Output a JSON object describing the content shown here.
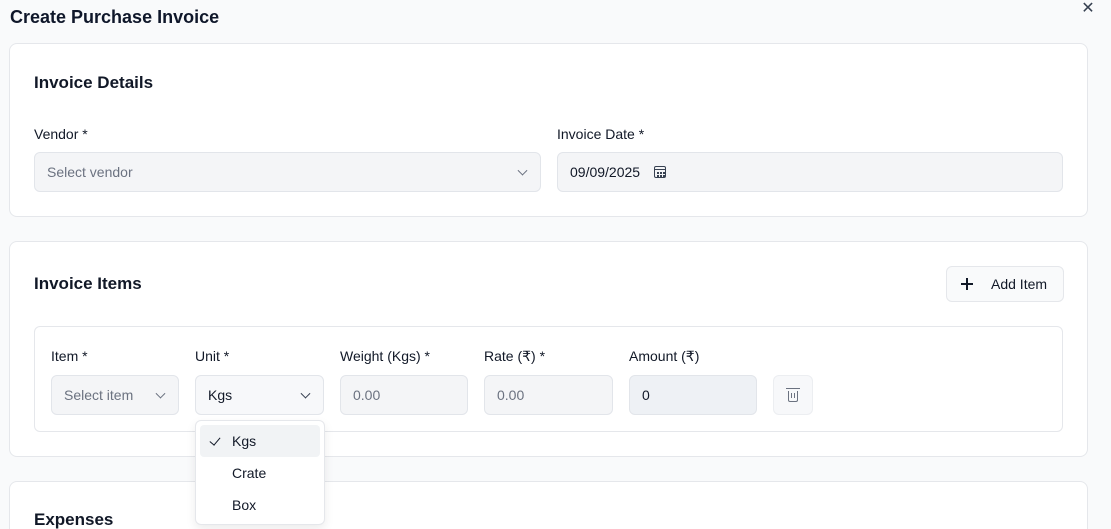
{
  "dialog": {
    "title": "Create Purchase Invoice",
    "close_icon": "close-icon"
  },
  "invoice_details": {
    "title": "Invoice Details",
    "vendor": {
      "label": "Vendor *",
      "placeholder": "Select vendor"
    },
    "invoice_date": {
      "label": "Invoice Date *",
      "value": "09/09/2025"
    }
  },
  "invoice_items": {
    "title": "Invoice Items",
    "add_item_label": "Add Item",
    "columns": {
      "item": "Item *",
      "unit": "Unit *",
      "weight": "Weight (Kgs) *",
      "rate": "Rate (₹) *",
      "amount": "Amount (₹)"
    },
    "row": {
      "item_placeholder": "Select item",
      "unit_value": "Kgs",
      "weight_placeholder": "0.00",
      "rate_placeholder": "0.00",
      "amount_value": "0"
    },
    "unit_options": [
      {
        "label": "Kgs",
        "selected": true
      },
      {
        "label": "Crate",
        "selected": false
      },
      {
        "label": "Box",
        "selected": false
      }
    ]
  },
  "expenses": {
    "title": "Expenses"
  }
}
